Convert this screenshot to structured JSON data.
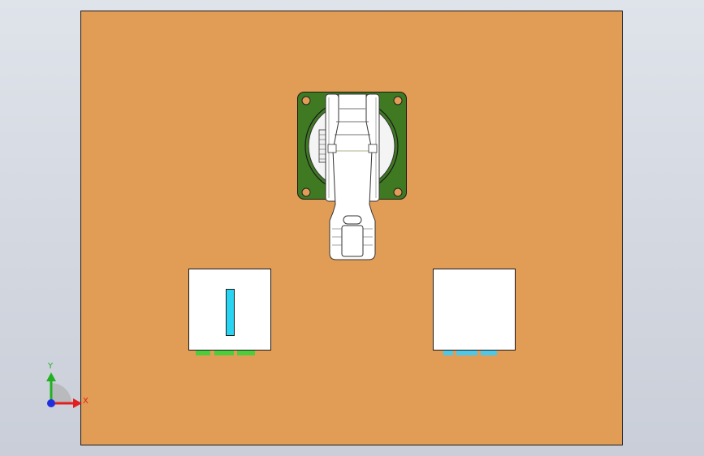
{
  "viewport": {
    "background_top": "#dfe3ea",
    "background_bottom": "#c9ced8"
  },
  "model": {
    "base_plate_color": "#e19c55",
    "base_plate_edge": "#1a1a1a",
    "robot_mount_color": "#3f7a22",
    "robot_mount_hole_color": "#e19c55",
    "robot_arm_color": "#ffffff",
    "left_station_color": "#ffffff",
    "left_station_part_color": "#29d3f2",
    "left_station_foot_color": "#4ccd3a",
    "right_station_color": "#ffffff",
    "right_station_foot_color": "#4fc8e8"
  },
  "triad": {
    "x_label": "X",
    "y_label": "Y",
    "x_color": "#e02020",
    "y_color": "#20b020",
    "z_color": "#2030e0"
  }
}
